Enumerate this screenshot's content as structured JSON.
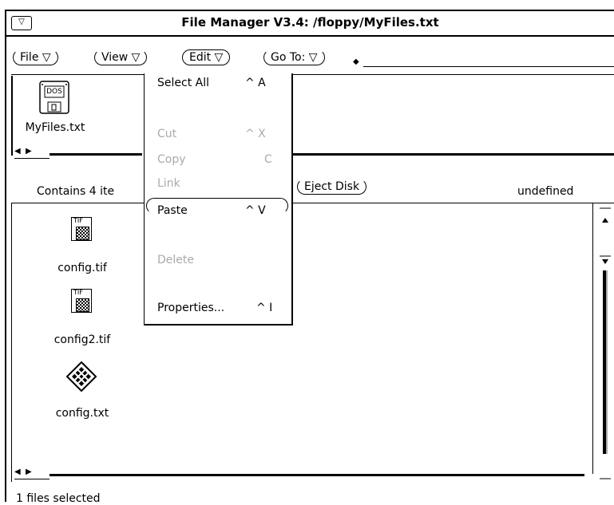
{
  "window": {
    "title": "File Manager V3.4: /floppy/MyFiles.txt",
    "menu_glyph": "▽"
  },
  "menubar": {
    "file": "File ▽",
    "view": "View ▽",
    "edit": "Edit ▽",
    "goto": "Go To: ▽",
    "goto_marker": "◆"
  },
  "top_pane": {
    "items": [
      {
        "label": "MyFiles.txt",
        "badge": "DOS"
      }
    ]
  },
  "status": {
    "contains": "Contains 4 ite",
    "eject_label": "Eject Disk",
    "right_text": "undefined",
    "footer": "1 files selected"
  },
  "file_pane": {
    "items": [
      {
        "label": "config.tif",
        "type": "TIF"
      },
      {
        "label": "config2.tif",
        "type": "TIF"
      },
      {
        "label": "config.txt",
        "type": "txt"
      }
    ]
  },
  "edit_menu": {
    "items": [
      {
        "label": "Select All",
        "accel": "^ A",
        "enabled": true
      },
      {
        "label": "Cut",
        "accel": "^ X",
        "enabled": false
      },
      {
        "label": "Copy",
        "accel": "C",
        "enabled": false
      },
      {
        "label": "Link",
        "accel": "",
        "enabled": false
      },
      {
        "label": "Paste",
        "accel": "^ V",
        "enabled": true
      },
      {
        "label": "Delete",
        "accel": "",
        "enabled": false
      },
      {
        "label": "Properties...",
        "accel": "^ I",
        "enabled": true
      }
    ]
  },
  "colors": {
    "background": "#ffffff",
    "foreground": "#000000",
    "disabled": "#aaaaaa"
  }
}
